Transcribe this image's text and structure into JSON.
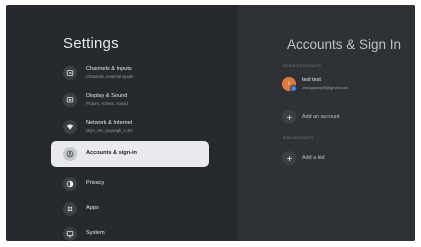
{
  "left": {
    "title": "Settings",
    "items": [
      {
        "label": "Channels & Inputs",
        "sub": "Channels, external inputs",
        "icon": "input-icon"
      },
      {
        "label": "Display & Sound",
        "sub": "Picture, screen, sound",
        "icon": "display-icon"
      },
      {
        "label": "Network & Internet",
        "sub": "DQA_HK_puyangli_2.4G",
        "icon": "wifi-icon"
      },
      {
        "label": "Accounts & sign-in",
        "sub": "",
        "icon": "account-icon"
      },
      {
        "label": "Privacy",
        "sub": "",
        "icon": "privacy-icon"
      },
      {
        "label": "Apps",
        "sub": "",
        "icon": "apps-icon"
      },
      {
        "label": "System",
        "sub": "",
        "icon": "system-icon"
      }
    ],
    "selected_index": 3
  },
  "right": {
    "title": "Accounts & Sign In",
    "section_google": "GOOGLE ACCOUNTS",
    "account": {
      "initial": "t",
      "name": "test test",
      "email": "zhangsang05@gmail.com"
    },
    "add_account": "Add an account",
    "section_kids": "KIDS ACCOUNTS",
    "add_kid": "Add a kid"
  },
  "colors": {
    "background": "#26292d",
    "panel": "#2e3136",
    "selected": "#e8eaed",
    "avatar": "#e07a3c"
  }
}
